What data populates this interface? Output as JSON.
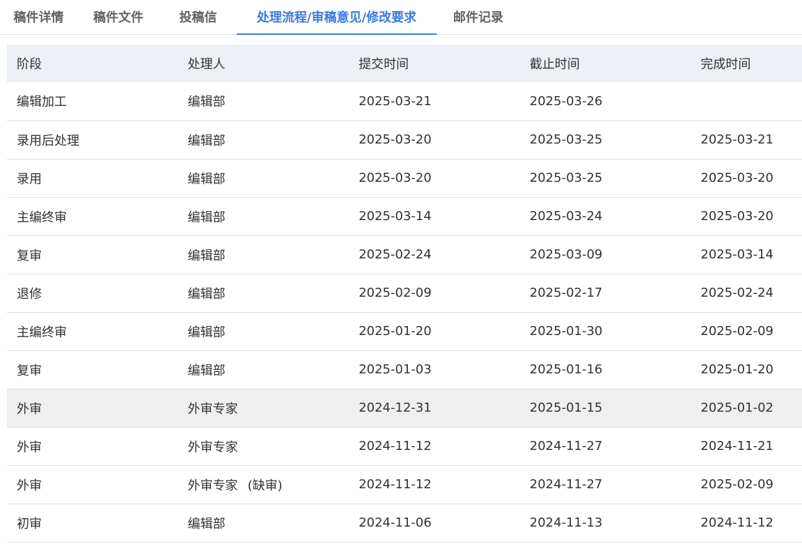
{
  "tabs": [
    {
      "label": "稿件详情",
      "active": false
    },
    {
      "label": "稿件文件",
      "active": false
    },
    {
      "label": "投稿信",
      "active": false
    },
    {
      "label": "处理流程/审稿意见/修改要求",
      "active": true
    },
    {
      "label": "邮件记录",
      "active": false
    }
  ],
  "table": {
    "headers": [
      "阶段",
      "处理人",
      "提交时间",
      "截止时间",
      "完成时间"
    ],
    "rows": [
      {
        "stage": "编辑加工",
        "handler": "编辑部",
        "handler_note": "",
        "submitted": "2025-03-21",
        "deadline": "2025-03-26",
        "completed": ""
      },
      {
        "stage": "录用后处理",
        "handler": "编辑部",
        "handler_note": "",
        "submitted": "2025-03-20",
        "deadline": "2025-03-25",
        "completed": "2025-03-21"
      },
      {
        "stage": "录用",
        "handler": "编辑部",
        "handler_note": "",
        "submitted": "2025-03-20",
        "deadline": "2025-03-25",
        "completed": "2025-03-20"
      },
      {
        "stage": "主编终审",
        "handler": "编辑部",
        "handler_note": "",
        "submitted": "2025-03-14",
        "deadline": "2025-03-24",
        "completed": "2025-03-20"
      },
      {
        "stage": "复审",
        "handler": "编辑部",
        "handler_note": "",
        "submitted": "2025-02-24",
        "deadline": "2025-03-09",
        "completed": "2025-03-14"
      },
      {
        "stage": "退修",
        "handler": "编辑部",
        "handler_note": "",
        "submitted": "2025-02-09",
        "deadline": "2025-02-17",
        "completed": "2025-02-24"
      },
      {
        "stage": "主编终审",
        "handler": "编辑部",
        "handler_note": "",
        "submitted": "2025-01-20",
        "deadline": "2025-01-30",
        "completed": "2025-02-09"
      },
      {
        "stage": "复审",
        "handler": "编辑部",
        "handler_note": "",
        "submitted": "2025-01-03",
        "deadline": "2025-01-16",
        "completed": "2025-01-20"
      },
      {
        "stage": "外审",
        "handler": "外审专家",
        "handler_note": "",
        "submitted": "2024-12-31",
        "deadline": "2025-01-15",
        "completed": "2025-01-02",
        "highlighted": true
      },
      {
        "stage": "外审",
        "handler": "外审专家",
        "handler_note": "",
        "submitted": "2024-11-12",
        "deadline": "2024-11-27",
        "completed": "2024-11-21"
      },
      {
        "stage": "外审",
        "handler": "外审专家",
        "handler_note": "(缺审)",
        "submitted": "2024-11-12",
        "deadline": "2024-11-27",
        "completed": "2025-02-09"
      },
      {
        "stage": "初审",
        "handler": "编辑部",
        "handler_note": "",
        "submitted": "2024-11-06",
        "deadline": "2024-11-13",
        "completed": "2024-11-12"
      }
    ]
  },
  "colors": {
    "accent": "#3b7bd9",
    "header_bg": "#ecf0f4",
    "highlight_row_bg": "#efefef",
    "border": "#dcdfe6"
  }
}
